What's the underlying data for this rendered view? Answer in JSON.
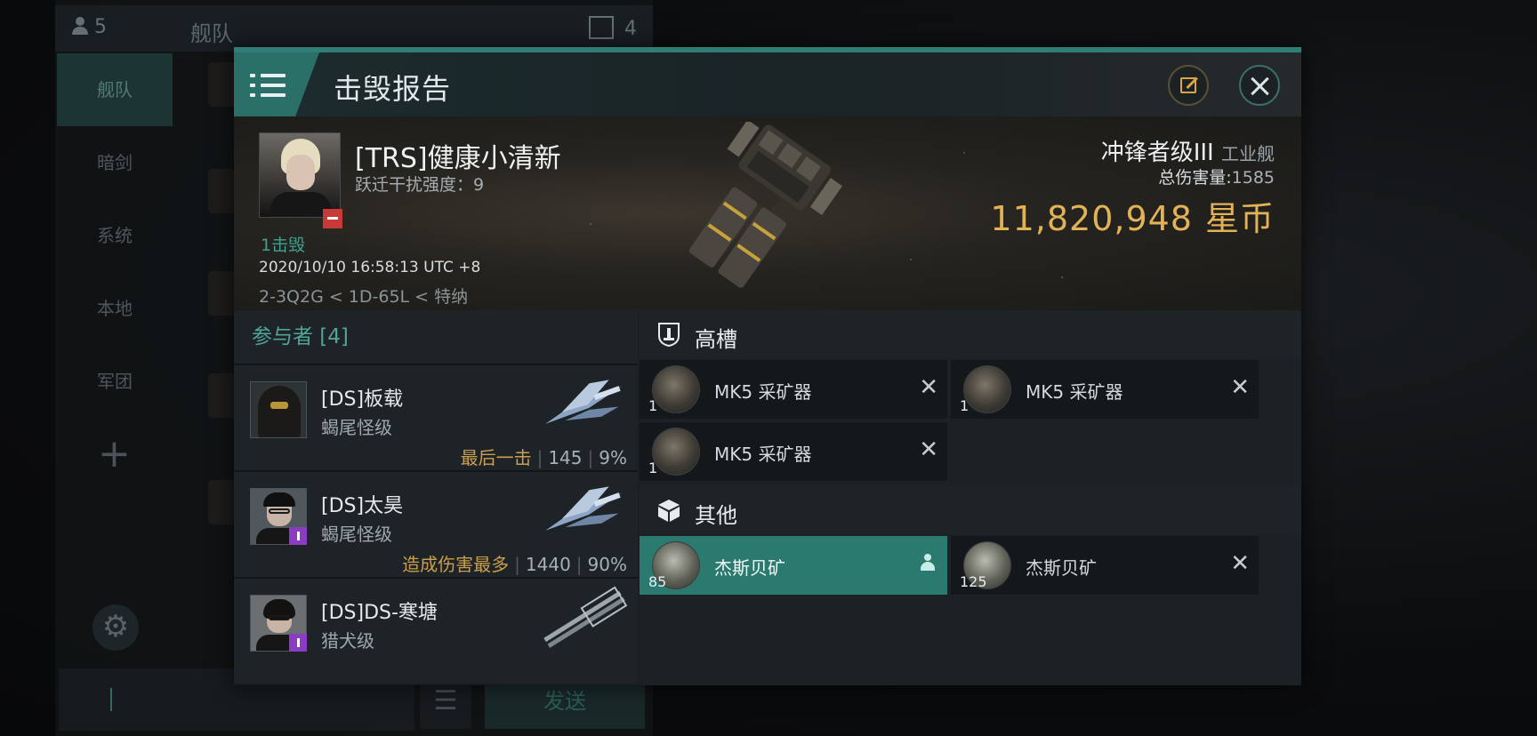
{
  "background": {
    "member_count": "5",
    "fleet_title": "舰队",
    "message_count": "4",
    "sidebar": [
      "舰队",
      "暗剑",
      "系统",
      "本地",
      "军团"
    ],
    "send_label": "发送"
  },
  "window": {
    "title": "击毁报告"
  },
  "victim": {
    "name": "[TRS]健康小清新",
    "warp_disruption": "跃迁干扰强度：9",
    "kills_tag": "1击毁",
    "timestamp": "2020/10/10 16:58:13 UTC +8",
    "location": "2-3Q2G < 1D-65L < 特纳",
    "ship_name": "冲锋者级III",
    "ship_class": "工业舰",
    "total_damage_label": "总伤害量:",
    "total_damage": "1585",
    "isk_value": "11,820,948",
    "isk_unit": "星币"
  },
  "participants": {
    "header": "参与者 [4]",
    "rows": [
      {
        "name": "[DS]板载",
        "ship": "蝎尾怪级",
        "tag": "最后一击",
        "damage": "145",
        "percent": "9%"
      },
      {
        "name": "[DS]太昊",
        "ship": "蝎尾怪级",
        "tag": "造成伤害最多",
        "damage": "1440",
        "percent": "90%"
      },
      {
        "name": "[DS]DS-寒塘",
        "ship": "猎犬级",
        "tag": "",
        "damage": "",
        "percent": ""
      }
    ]
  },
  "modules": {
    "high_slots_title": "高槽",
    "high_slots": [
      {
        "name": "MK5 采矿器",
        "qty": "1"
      },
      {
        "name": "MK5 采矿器",
        "qty": "1"
      },
      {
        "name": "MK5 采矿器",
        "qty": "1"
      }
    ],
    "other_title": "其他",
    "other": [
      {
        "name": "杰斯贝矿",
        "qty": "85",
        "state": "dropped"
      },
      {
        "name": "杰斯贝矿",
        "qty": "125",
        "state": "destroyed"
      }
    ]
  },
  "colors": {
    "accent": "#2f7d74",
    "isk_gold": "#e2b257",
    "kill_green": "#3fa091",
    "corp_badge_red": "#c8393a",
    "role_badge_purple": "#8a3cc2"
  }
}
